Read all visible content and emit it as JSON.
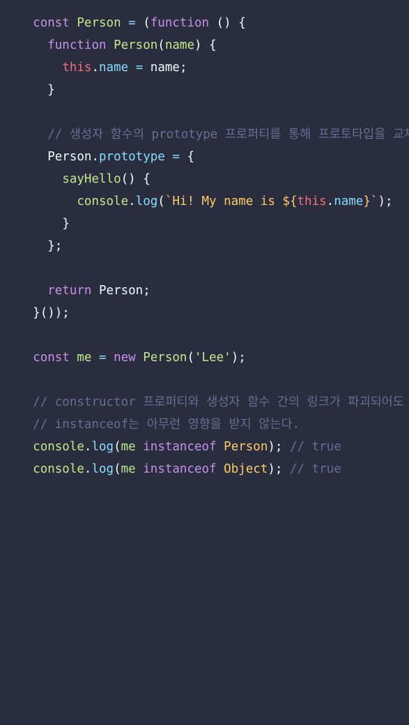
{
  "code_lines": [
    [
      "const",
      " ",
      "Person",
      " = ",
      "(",
      "function",
      " ",
      "()",
      " {"
    ],
    [
      "  ",
      "function",
      " ",
      "Person",
      "(",
      "name",
      ")",
      " {"
    ],
    [
      "    ",
      "this",
      ".",
      "name",
      " = ",
      "name",
      ";"
    ],
    [
      "  ",
      "}"
    ],
    [],
    [
      "  ",
      "// 생성자 함수의 prototype 프로퍼티를 통해 프로토타입을 교체"
    ],
    [
      "  ",
      "Person",
      ".",
      "prototype",
      " = ",
      "{"
    ],
    [
      "    ",
      "sayHello",
      "()",
      " {"
    ],
    [
      "      ",
      "console",
      ".",
      "log",
      "(",
      "`Hi! My name is ${",
      "this",
      ".",
      "name",
      "}`",
      ");"
    ],
    [
      "    ",
      "}"
    ],
    [
      "  ",
      "};"
    ],
    [],
    [
      "  ",
      "return",
      " ",
      "Person",
      ";"
    ],
    [
      "}",
      "());"
    ],
    [],
    [
      "const",
      " ",
      "me",
      " = ",
      "new",
      " ",
      "Person",
      "(",
      "'Lee'",
      ");"
    ],
    [],
    [
      "// constructor 프로퍼티와 생성자 함수 간의 링크가 파괴되어도"
    ],
    [
      "// instanceof는 아무런 영향을 받지 않는다."
    ],
    [
      "console",
      ".",
      "log",
      "(",
      "me",
      " ",
      "instanceof",
      " ",
      "Person",
      ");",
      " ",
      "// true"
    ],
    [
      "console",
      ".",
      "log",
      "(",
      "me",
      " ",
      "instanceof",
      " ",
      "Object",
      ");",
      " ",
      "// true"
    ]
  ]
}
